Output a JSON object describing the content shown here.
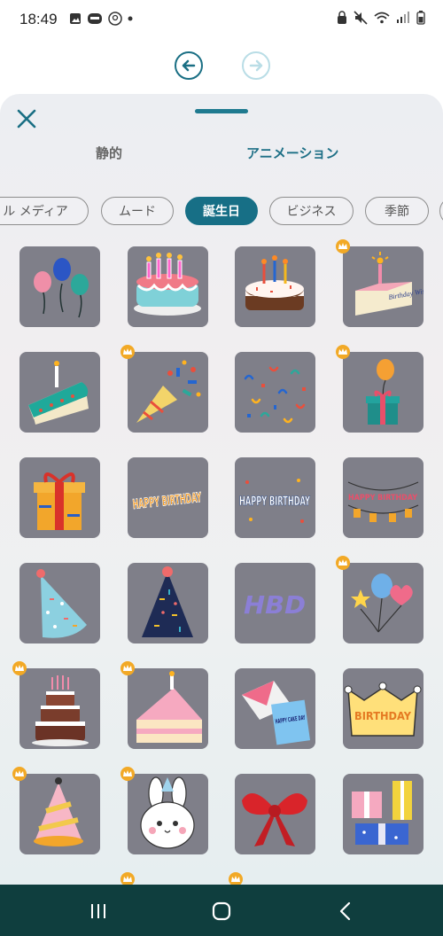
{
  "status": {
    "time": "18:49"
  },
  "sheet": {
    "tabs": [
      {
        "label": "静的",
        "active": false
      },
      {
        "label": "アニメーション",
        "active": true
      }
    ],
    "chips": [
      {
        "label": "ル メディア",
        "active": false
      },
      {
        "label": "ムード",
        "active": false
      },
      {
        "label": "誕生日",
        "active": true
      },
      {
        "label": "ビジネス",
        "active": false
      },
      {
        "label": "季節",
        "active": false
      }
    ],
    "stickers": [
      {
        "icon": "balloons-sticker",
        "premium": false
      },
      {
        "icon": "birthday-cake-candles-sticker",
        "premium": false
      },
      {
        "icon": "chocolate-cake-sticker",
        "premium": false
      },
      {
        "icon": "birthday-wishes-cake-sticker",
        "premium": true,
        "text": "Birthday Wishes"
      },
      {
        "icon": "cake-slice-sticker",
        "premium": false
      },
      {
        "icon": "party-popper-sticker",
        "premium": true
      },
      {
        "icon": "confetti-sticker",
        "premium": false
      },
      {
        "icon": "gift-balloon-sticker",
        "premium": true
      },
      {
        "icon": "gift-box-sticker",
        "premium": false
      },
      {
        "icon": "happy-birthday-text-sticker",
        "premium": false,
        "text": "HAPPY BIRTHDAY"
      },
      {
        "icon": "happy-birthday-white-text-sticker",
        "premium": false,
        "text": "HAPPY BIRTHDAY"
      },
      {
        "icon": "happy-birthday-banner-sticker",
        "premium": false,
        "text": "HAPPY BIRTHDAY"
      },
      {
        "icon": "party-hat-blue-sticker",
        "premium": false
      },
      {
        "icon": "party-hat-navy-sticker",
        "premium": false
      },
      {
        "icon": "hbd-text-sticker",
        "premium": false,
        "text": "HBD"
      },
      {
        "icon": "star-heart-balloons-sticker",
        "premium": true
      },
      {
        "icon": "tiered-cake-sticker",
        "premium": true
      },
      {
        "icon": "cake-piece-sticker",
        "premium": true
      },
      {
        "icon": "happy-cake-day-card-sticker",
        "premium": false,
        "text": "HAPPY CAKE DAY"
      },
      {
        "icon": "birthday-crown-sticker",
        "premium": false,
        "text": "BIRTHDAY"
      },
      {
        "icon": "party-hat-pink-sticker",
        "premium": true
      },
      {
        "icon": "bunny-sticker",
        "premium": true
      },
      {
        "icon": "red-bow-sticker",
        "premium": false
      },
      {
        "icon": "gift-boxes-sticker",
        "premium": false
      }
    ]
  },
  "colors": {
    "accent": "#176f86",
    "tile": "#7f7f89",
    "premium": "#f2a926",
    "navbar": "#0f3e3e"
  }
}
